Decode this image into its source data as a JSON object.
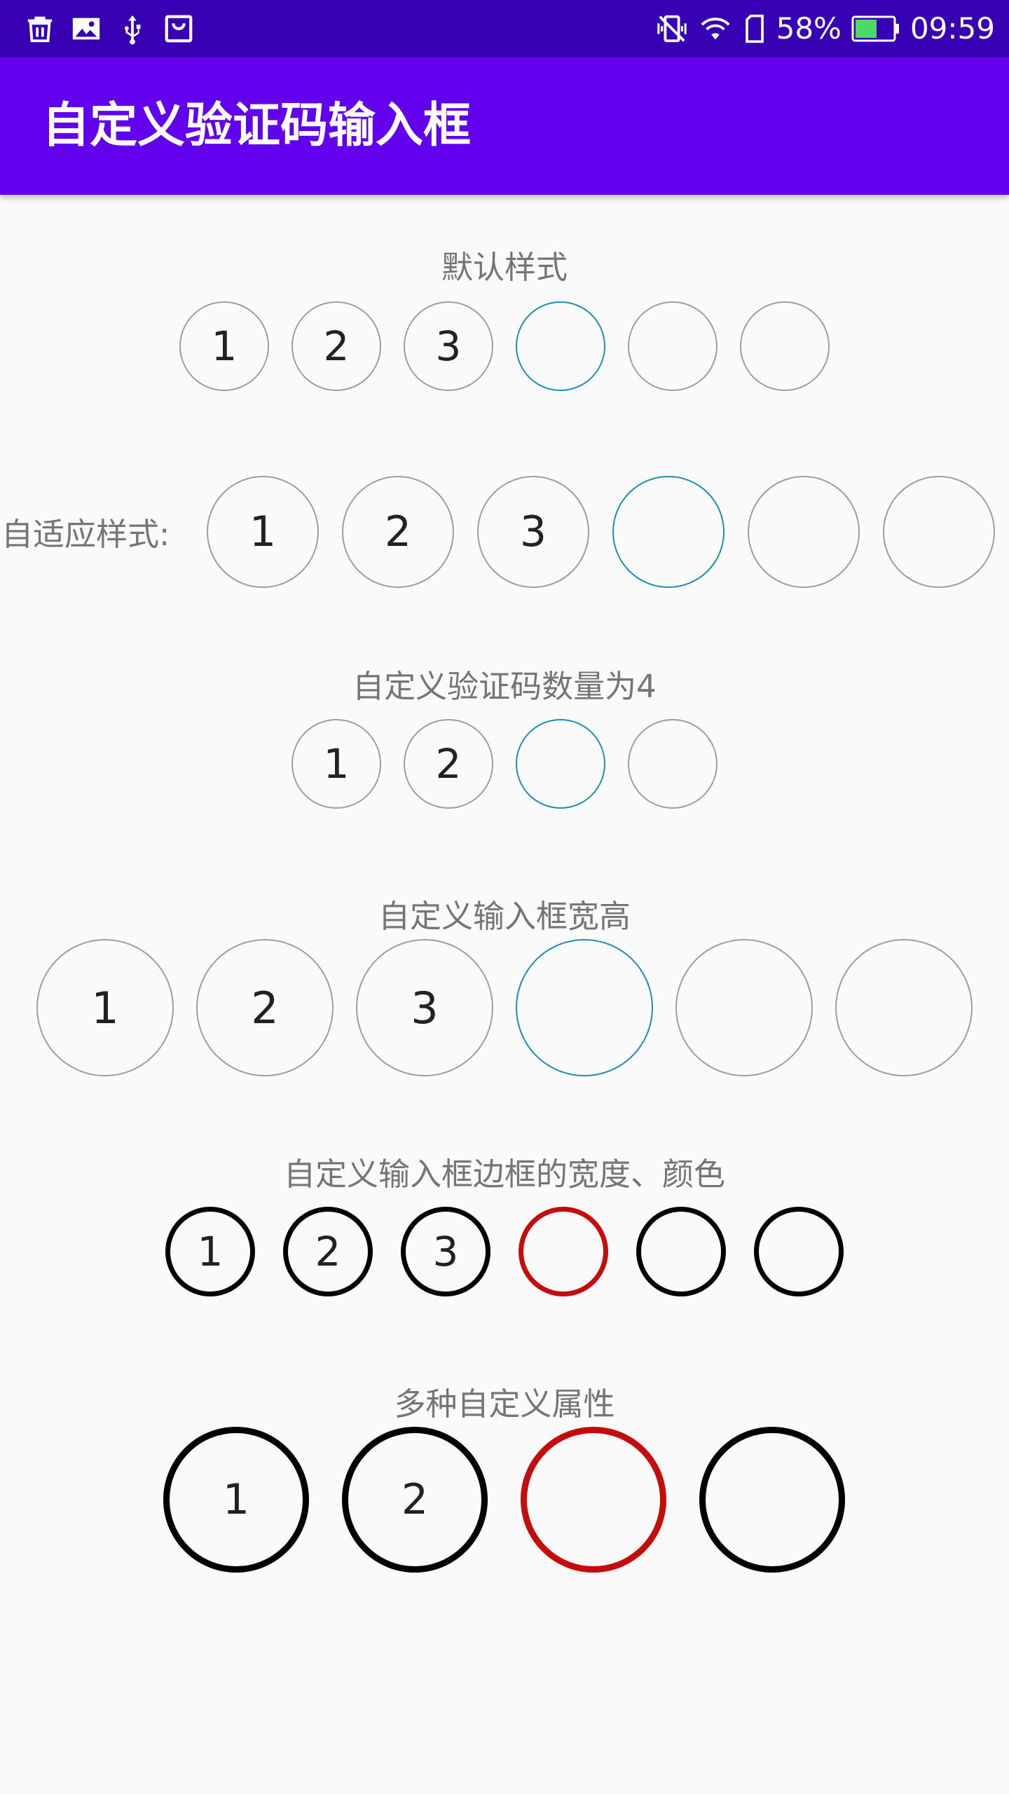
{
  "status_bar": {
    "battery_percent": "58%",
    "time": "09:59",
    "battery_level": 0.58,
    "left_icons": [
      "trash-icon",
      "image-icon",
      "usb-icon",
      "shopping-bag-icon"
    ],
    "right_icons": [
      "vibrate-icon",
      "wifi-icon",
      "sim-icon",
      "battery-icon"
    ]
  },
  "app_bar": {
    "title": "自定义验证码输入框"
  },
  "sections": {
    "default_style": {
      "label": "默认样式",
      "values": [
        "1",
        "2",
        "3",
        "",
        "",
        ""
      ],
      "active_index": 3
    },
    "adaptive_style": {
      "label": "自适应样式:",
      "values": [
        "1",
        "2",
        "3",
        "",
        "",
        ""
      ],
      "active_index": 3
    },
    "count_four": {
      "label": "自定义验证码数量为4",
      "values": [
        "1",
        "2",
        "",
        ""
      ],
      "active_index": 2
    },
    "size_custom": {
      "label": "自定义输入框宽高",
      "values": [
        "1",
        "2",
        "3",
        "",
        "",
        ""
      ],
      "active_index": 3
    },
    "border_custom": {
      "label": "自定义输入框边框的宽度、颜色",
      "values": [
        "1",
        "2",
        "3",
        "",
        "",
        ""
      ],
      "active_index": 3
    },
    "multi_custom": {
      "label": "多种自定义属性",
      "values": [
        "1",
        "2",
        "",
        ""
      ],
      "active_index": 2
    }
  },
  "colors": {
    "status_bar": "#3700b3",
    "app_bar": "#6200ee",
    "background": "#fafafa",
    "label_text": "#757575",
    "box_border": "#9e9e9e",
    "box_active": "#1a8fb3",
    "thick_border": "#000000",
    "thick_active": "#c40c0c"
  }
}
